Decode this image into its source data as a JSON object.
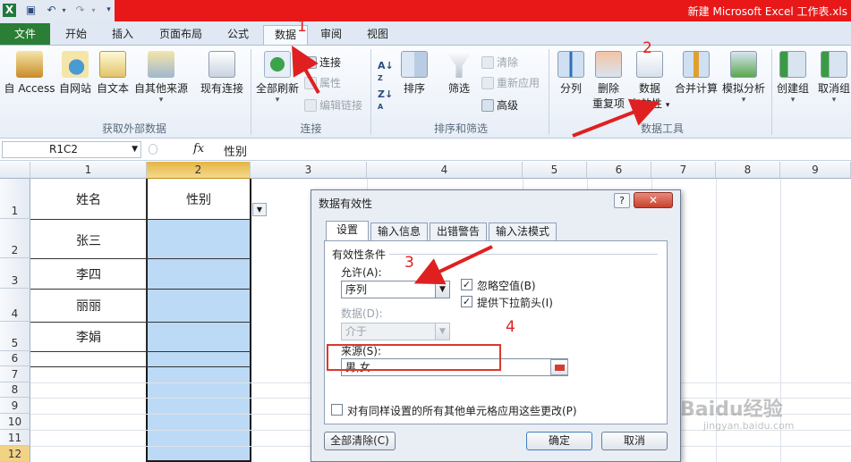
{
  "window": {
    "title": "新建 Microsoft Excel 工作表.xls",
    "quick_access": [
      "excel-logo",
      "save-icon",
      "undo-icon",
      "redo-icon",
      "customize-icon"
    ]
  },
  "tabs": [
    "文件",
    "开始",
    "插入",
    "页面布局",
    "公式",
    "数据",
    "审阅",
    "视图"
  ],
  "active_tab": "数据",
  "ribbon": {
    "get_external": {
      "buttons": [
        "自 Access",
        "自网站",
        "自文本",
        "自其他来源",
        "现有连接"
      ],
      "group_label": "获取外部数据"
    },
    "connections": {
      "refresh_all": "全部刷新",
      "connections": "连接",
      "properties": "属性",
      "edit_links": "编辑链接",
      "group_label": "连接"
    },
    "sort_filter": {
      "sort": "排序",
      "filter": "筛选",
      "clear": "清除",
      "reapply": "重新应用",
      "advanced": "高级",
      "group_label": "排序和筛选"
    },
    "data_tools": {
      "text_to_columns": "分列",
      "remove_dup_1": "删除",
      "remove_dup_2": "重复项",
      "validation_1": "数据",
      "validation_2": "有效性",
      "consolidate": "合并计算",
      "what_if": "模拟分析",
      "group_label": "数据工具"
    },
    "outline": {
      "group": "创建组",
      "ungroup": "取消组"
    }
  },
  "formula_bar": {
    "name_box": "R1C2",
    "fx": "fx",
    "content": "性别"
  },
  "grid": {
    "columns": [
      "1",
      "2",
      "3",
      "4",
      "5",
      "6",
      "7",
      "8",
      "9"
    ],
    "rows": [
      "1",
      "2",
      "3",
      "4",
      "5",
      "6",
      "7",
      "8",
      "9",
      "10",
      "11",
      "12"
    ],
    "cells": {
      "A1": "姓名",
      "B1": "性别",
      "A2": "张三",
      "A3": "李四",
      "A4": "丽丽",
      "A5": "李娟"
    }
  },
  "dialog": {
    "title": "数据有效性",
    "help": "?",
    "close": "✕",
    "tabs": [
      "设置",
      "输入信息",
      "出错警告",
      "输入法模式"
    ],
    "section": "有效性条件",
    "allow_label": "允许(A):",
    "allow_value": "序列",
    "ignore_blank": "忽略空值(B)",
    "dropdown": "提供下拉箭头(I)",
    "data_label": "数据(D):",
    "data_value": "介于",
    "source_label": "来源(S):",
    "source_value": "男,女",
    "apply_all": "对有同样设置的所有其他单元格应用这些更改(P)",
    "clear_all": "全部清除(C)",
    "ok": "确定",
    "cancel": "取消"
  },
  "annotations": [
    "1",
    "2",
    "3",
    "4"
  ],
  "watermark": {
    "brand": "Baidu经验",
    "url": "jingyan.baidu.com"
  },
  "colors": {
    "title_red": "#e81818",
    "file_tab": "#2a7e35",
    "selected_fill": "#bcdaf5",
    "annotation_red": "#e02020"
  }
}
